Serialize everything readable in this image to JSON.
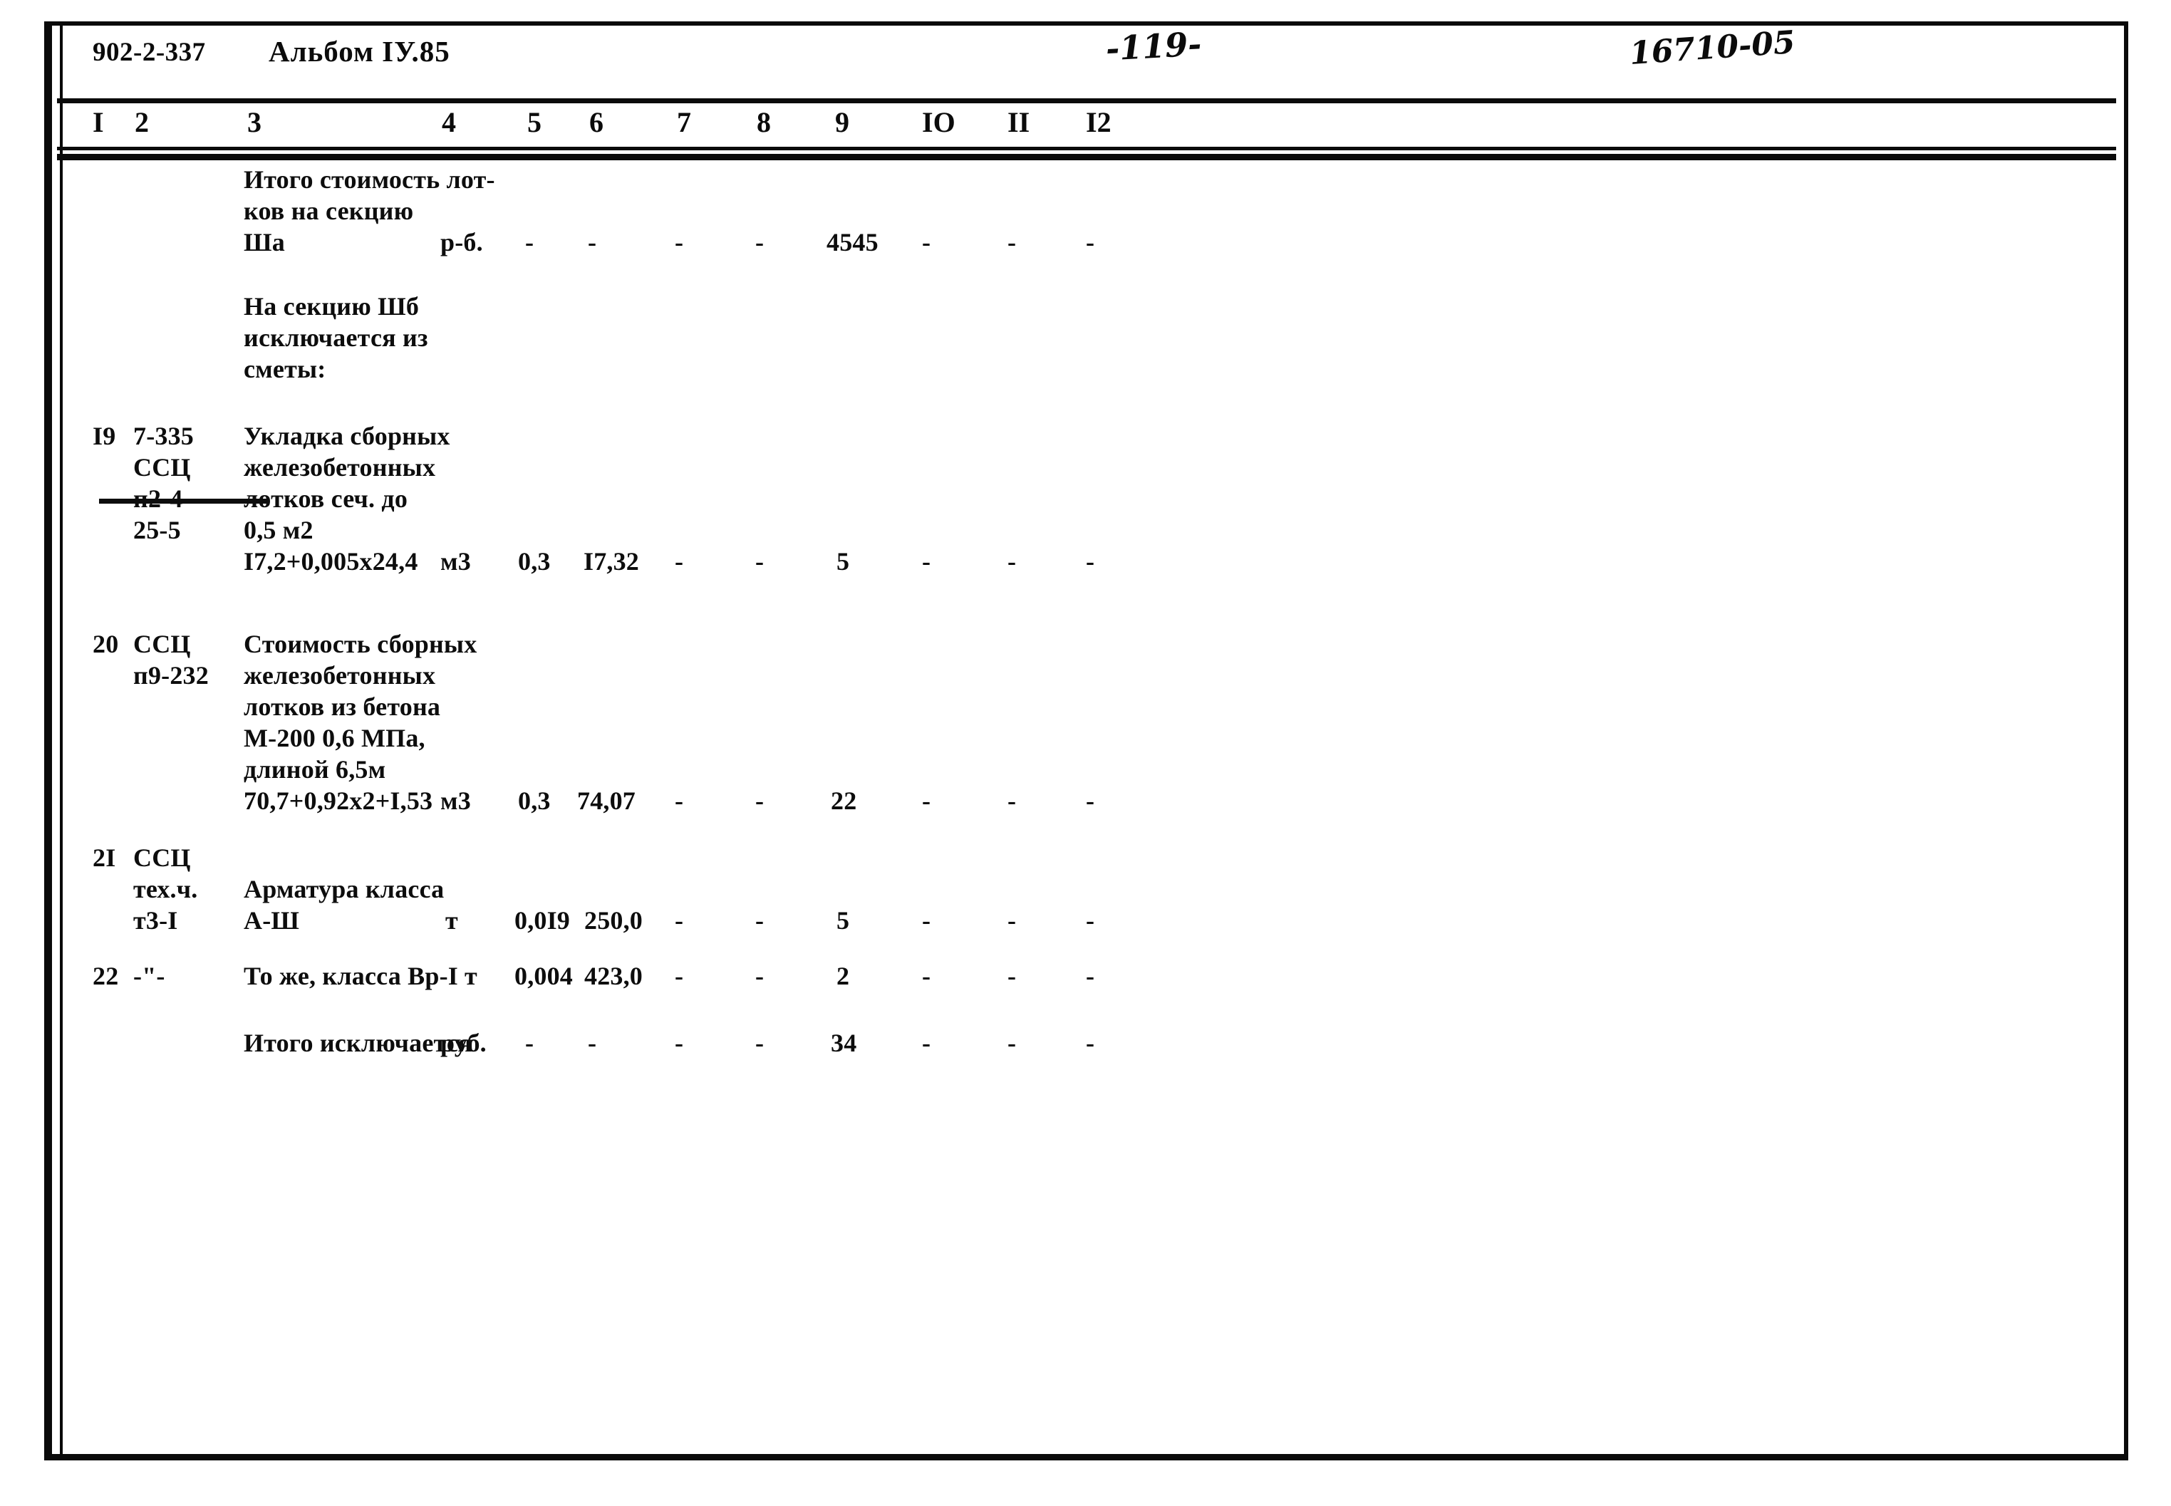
{
  "page": {
    "doc_code": "902-2-337",
    "album": "Альбом IУ.85",
    "page_number": "-119-",
    "archive_stamp": "16710-05"
  },
  "table": {
    "column_numbers": [
      "I",
      "2",
      "3",
      "4",
      "5",
      "6",
      "7",
      "8",
      "9",
      "IO",
      "II",
      "I2"
    ],
    "rows": [
      {
        "no": "",
        "code": "",
        "description": "Итого стоимость лот-\nков на секцию\nШа",
        "unit": "р-б.",
        "c5": "-",
        "c6": "-",
        "c7": "-",
        "c8": "-",
        "c9": "4545",
        "c10": "-",
        "c11": "-",
        "c12": "-"
      },
      {
        "no": "",
        "code": "",
        "description": "На секцию Шб\nисключается из\nсметы:",
        "unit": "",
        "c5": "",
        "c6": "",
        "c7": "",
        "c8": "",
        "c9": "",
        "c10": "",
        "c11": "",
        "c12": ""
      },
      {
        "no": "I9",
        "code_line1": "7-335",
        "code_line2": "ССЦ",
        "code_line3_struck": "п2-4",
        "code_line4": "25-5",
        "description": "Укладка сборных\nжелезобетонных\nлотков сеч. до\n0,5 м2\nI7,2+0,005х24,4",
        "unit": "м3",
        "c5": "0,3",
        "c6": "I7,32",
        "c7": "-",
        "c8": "-",
        "c9": "5",
        "c10": "-",
        "c11": "-",
        "c12": "-"
      },
      {
        "no": "20",
        "code_line1": "ССЦ",
        "code_line2": "п9-232",
        "description": "Стоимость сборных\nжелезобетонных\nлотков из бетона\nМ-200 0,6 МПа,\nдлиной 6,5м\n70,7+0,92х2+I,53",
        "unit": "м3",
        "c5": "0,3",
        "c6": "74,07",
        "c7": "-",
        "c8": "-",
        "c9": "22",
        "c10": "-",
        "c11": "-",
        "c12": "-"
      },
      {
        "no": "2I",
        "code_line1": "ССЦ",
        "code_line2": "тех.ч.",
        "code_line3": "т3-I",
        "description": "Арматура класса\nА-Ш",
        "unit": "т",
        "c5": "0,0I9",
        "c6": "250,0",
        "c7": "-",
        "c8": "-",
        "c9": "5",
        "c10": "-",
        "c11": "-",
        "c12": "-"
      },
      {
        "no": "22",
        "code_line1": "-\"-",
        "description": "То же, класса Вр-I",
        "unit": "т",
        "c5": "0,004",
        "c6": "423,0",
        "c7": "-",
        "c8": "-",
        "c9": "2",
        "c10": "-",
        "c11": "-",
        "c12": "-"
      },
      {
        "no": "",
        "code_line1": "",
        "description": "Итого исключается",
        "unit": "руб.",
        "c5": "-",
        "c6": "-",
        "c7": "-",
        "c8": "-",
        "c9": "34",
        "c10": "-",
        "c11": "-",
        "c12": "-"
      }
    ]
  }
}
